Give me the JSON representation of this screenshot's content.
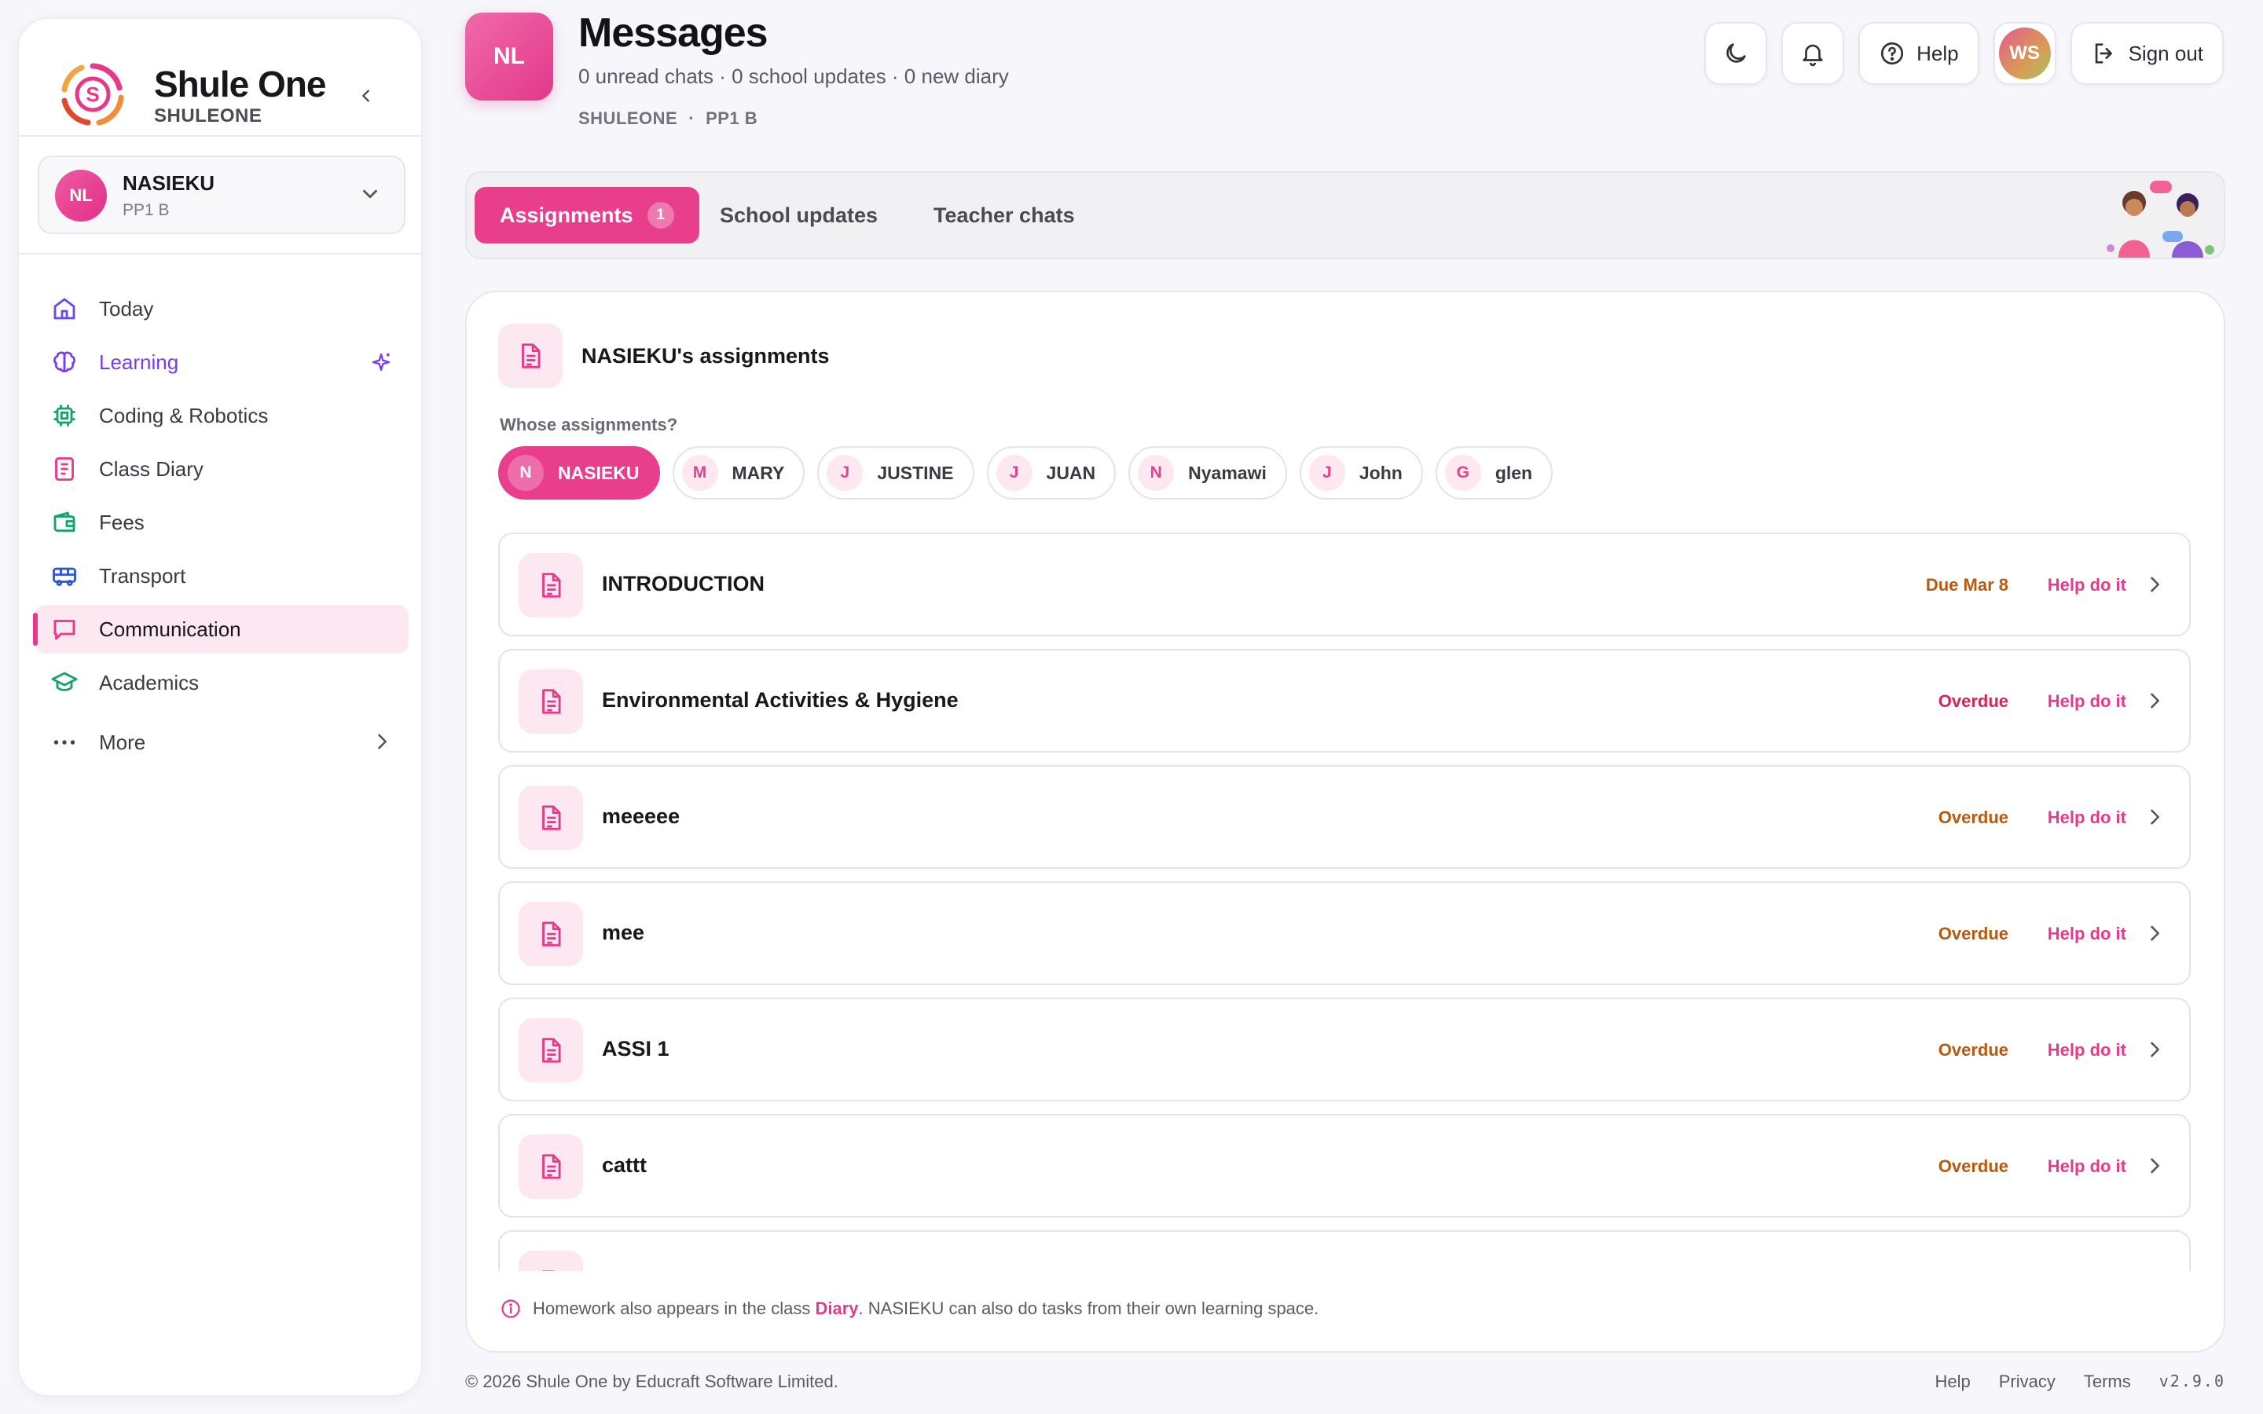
{
  "brand": {
    "name": "Shule One",
    "subtitle": "SHULEONE"
  },
  "student": {
    "initials": "NL",
    "name": "NASIEKU",
    "class": "PP1 B"
  },
  "nav": {
    "items": [
      {
        "label": "Today",
        "icon": "home-icon"
      },
      {
        "label": "Learning",
        "icon": "brain-icon",
        "trailing_icon": "sparkle-icon"
      },
      {
        "label": "Coding & Robotics",
        "icon": "cpu-icon"
      },
      {
        "label": "Class Diary",
        "icon": "notebook-icon"
      },
      {
        "label": "Fees",
        "icon": "wallet-icon"
      },
      {
        "label": "Transport",
        "icon": "bus-icon"
      },
      {
        "label": "Communication",
        "icon": "chat-icon",
        "active": true
      },
      {
        "label": "Academics",
        "icon": "graduation-cap-icon"
      }
    ],
    "more_label": "More"
  },
  "header": {
    "avatar_initials": "NL",
    "title": "Messages",
    "subtitle": "0 unread chats · 0 school updates · 0 new diary",
    "crumbs": [
      "SHULEONE",
      "PP1 B"
    ],
    "crumb_separator": "·",
    "help_label": "Help",
    "user_initials": "WS",
    "signout_label": "Sign out"
  },
  "tabs": [
    {
      "label": "Assignments",
      "count": "1",
      "active": true
    },
    {
      "label": "School updates"
    },
    {
      "label": "Teacher chats"
    }
  ],
  "assignments": {
    "title": "NASIEKU's assignments",
    "whose_label": "Whose assignments?",
    "children": [
      {
        "initial": "N",
        "name": "NASIEKU",
        "active": true
      },
      {
        "initial": "M",
        "name": "MARY"
      },
      {
        "initial": "J",
        "name": "JUSTINE"
      },
      {
        "initial": "J",
        "name": "JUAN"
      },
      {
        "initial": "N",
        "name": "Nyamawi"
      },
      {
        "initial": "J",
        "name": "John"
      },
      {
        "initial": "G",
        "name": "glen"
      }
    ],
    "help_label": "Help do it",
    "items": [
      {
        "title": "INTRODUCTION",
        "status": "Due Mar 8",
        "status_color": "#b8590e"
      },
      {
        "title": "Environmental Activities & Hygiene",
        "status": "Overdue",
        "status_color": "#d4245c"
      },
      {
        "title": "meeeee",
        "status": "Overdue",
        "status_color": "#b8590e"
      },
      {
        "title": "mee",
        "status": "Overdue",
        "status_color": "#b8590e"
      },
      {
        "title": "ASSI 1",
        "status": "Overdue",
        "status_color": "#b8590e"
      },
      {
        "title": "cattt",
        "status": "Overdue",
        "status_color": "#b8590e"
      },
      {
        "title": "",
        "status": "",
        "status_color": "#b8590e"
      }
    ],
    "note": {
      "before": "Homework also appears in the class ",
      "link": "Diary",
      "after": ". NASIEKU can also do tasks from their own learning space."
    }
  },
  "footer": {
    "copyright": "© 2026 Shule One by Educraft Software Limited.",
    "links": [
      "Help",
      "Privacy",
      "Terms"
    ],
    "version": "v2.9.0"
  },
  "colors": {
    "accent": "#e8388a",
    "learning": "#7c3aed",
    "due": "#b8590e",
    "overdue": "#d4245c"
  }
}
